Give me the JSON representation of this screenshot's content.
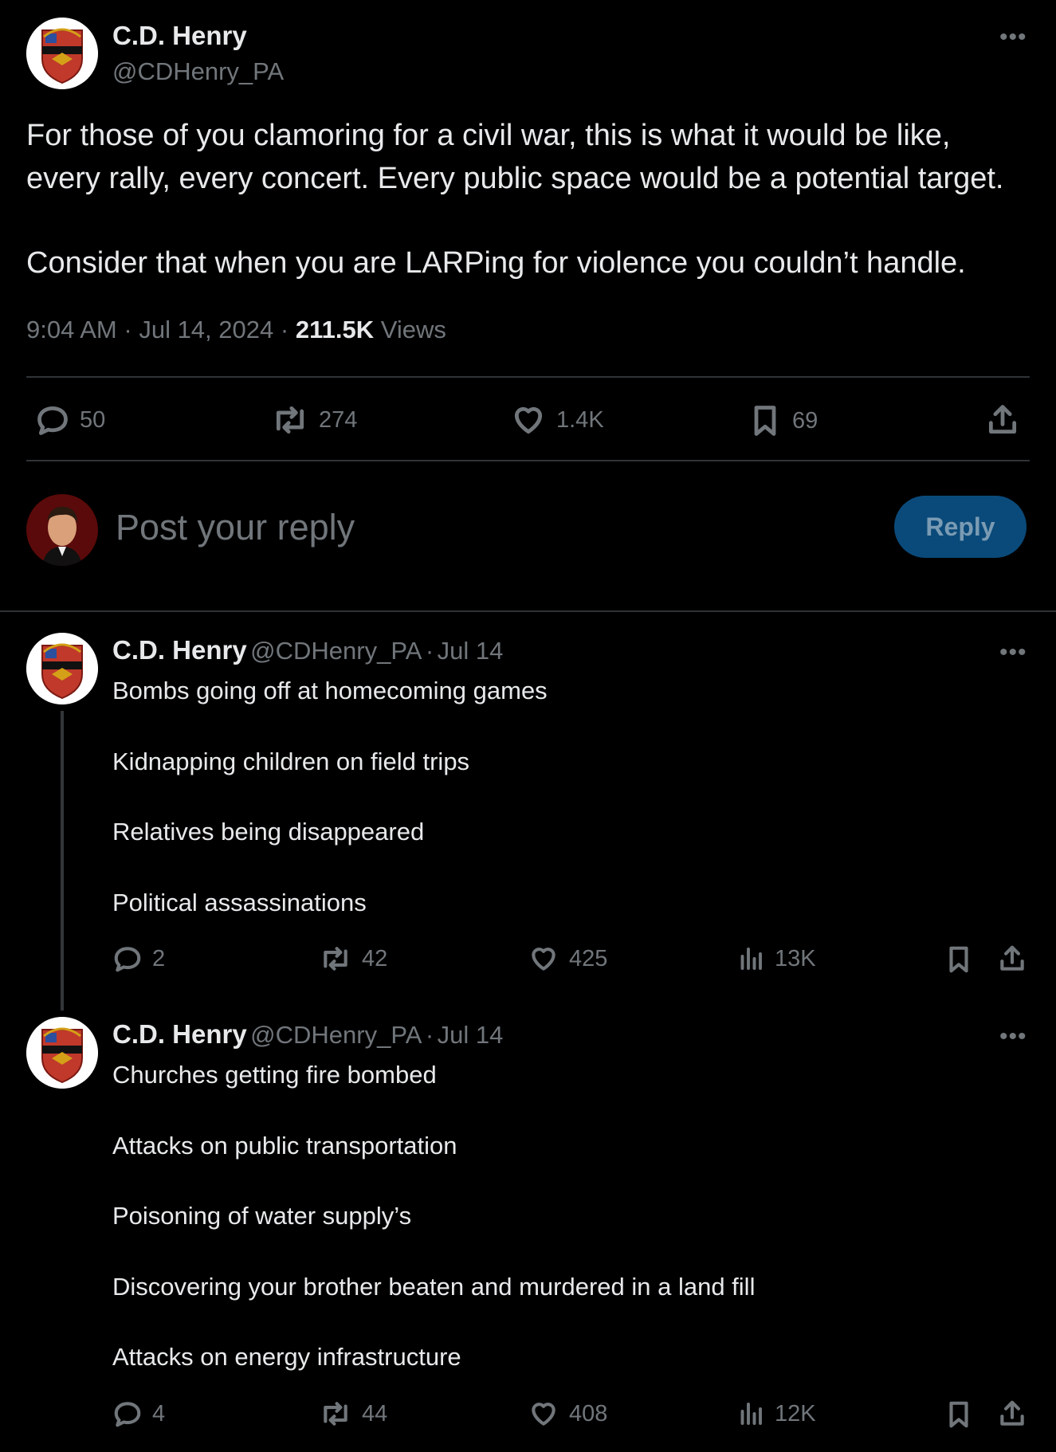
{
  "main_post": {
    "author_name": "C.D. Henry",
    "author_handle": "@CDHenry_PA",
    "text_line1": "For those of you clamoring for a civil war, this is what it would be like,",
    "text_line2": "every rally, every concert. Every public space would be a potential target.",
    "text_line3": "Consider that when you are LARPing for violence you couldn’t handle.",
    "time": "9:04 AM",
    "date": "Jul 14, 2024",
    "views_count": "211.5K",
    "views_label": "Views",
    "replies": "50",
    "reposts": "274",
    "likes": "1.4K",
    "bookmarks": "69"
  },
  "composer": {
    "placeholder": "Post your reply",
    "reply_button": "Reply"
  },
  "replies": [
    {
      "author_name": "C.D. Henry",
      "author_handle": "@CDHenry_PA",
      "date": "Jul 14",
      "lines": [
        "Bombs going off at homecoming games",
        "Kidnapping children on field trips",
        "Relatives being disappeared",
        "Political assassinations"
      ],
      "replies": "2",
      "reposts": "42",
      "likes": "425",
      "views": "13K"
    },
    {
      "author_name": "C.D. Henry",
      "author_handle": "@CDHenry_PA",
      "date": "Jul 14",
      "lines": [
        "Churches getting fire bombed",
        "Attacks on public transportation",
        "Poisoning of water supply’s",
        "Discovering your brother beaten and murdered in a land fill",
        "Attacks on energy infrastructure"
      ],
      "replies": "4",
      "reposts": "44",
      "likes": "408",
      "views": "12K"
    }
  ],
  "separator": "·",
  "more_glyph": "•••",
  "icons": [
    "reply-icon",
    "repost-icon",
    "like-icon",
    "bookmark-icon",
    "share-icon",
    "views-icon",
    "more-icon"
  ]
}
